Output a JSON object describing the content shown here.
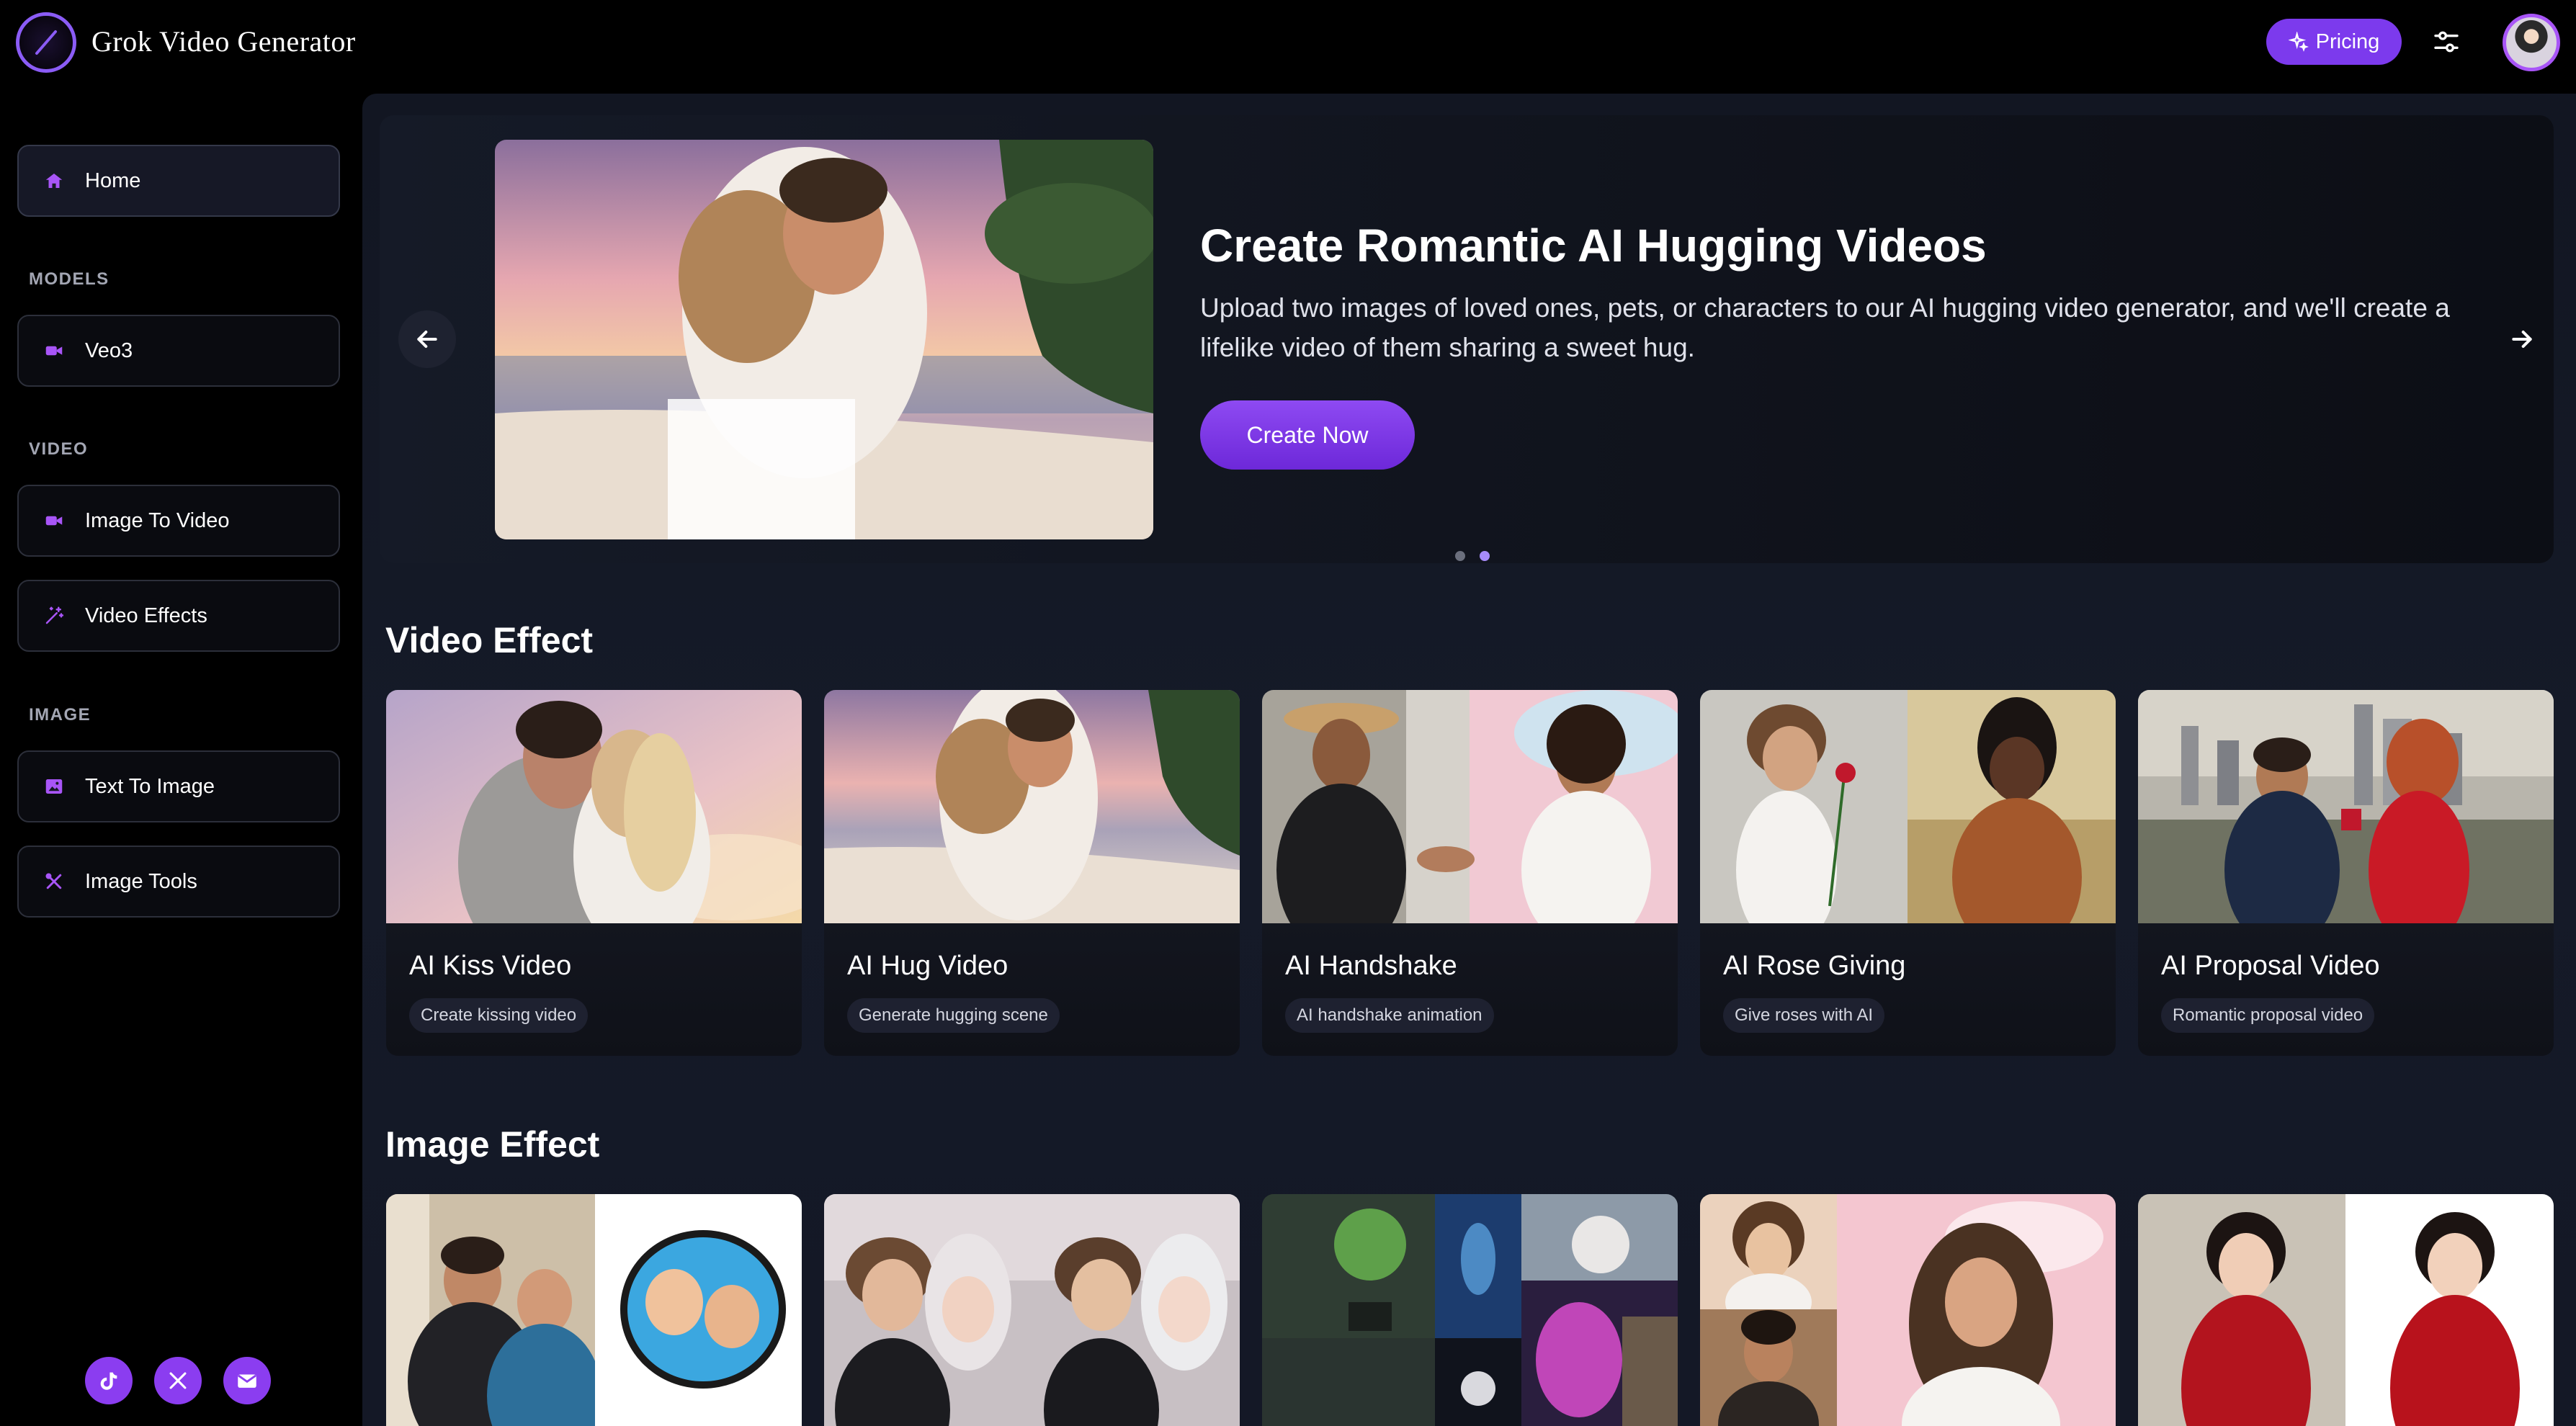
{
  "header": {
    "app_title": "Grok Video Generator",
    "pricing_label": "Pricing",
    "icons": [
      "logo-icon",
      "sparkle-icon",
      "sliders-icon",
      "user-avatar"
    ]
  },
  "sidebar": {
    "home_label": "Home",
    "sections": {
      "models": "MODELS",
      "video": "VIDEO",
      "image": "IMAGE"
    },
    "items": [
      {
        "label": "Veo3",
        "icon": "video-camera-icon"
      },
      {
        "label": "Image To Video",
        "icon": "video-camera-icon"
      },
      {
        "label": "Video Effects",
        "icon": "magic-wand-icon"
      },
      {
        "label": "Text To Image",
        "icon": "image-icon"
      },
      {
        "label": "Image Tools",
        "icon": "tools-icon"
      }
    ],
    "social": [
      "tiktok-icon",
      "x-icon",
      "mail-icon"
    ]
  },
  "hero": {
    "title": "Create Romantic AI Hugging Videos",
    "description": "Upload two images of loved ones, pets, or characters to our AI hugging video generator, and we'll create a lifelike video of them sharing a sweet hug.",
    "cta_label": "Create Now",
    "slide_count": 2,
    "active_slide": 2
  },
  "video_effect": {
    "title": "Video Effect",
    "cards": [
      {
        "title": "AI Kiss Video",
        "tag": "Create kissing video"
      },
      {
        "title": "AI Hug Video",
        "tag": "Generate hugging scene"
      },
      {
        "title": "AI Handshake",
        "tag": "AI handshake animation"
      },
      {
        "title": "AI Rose Giving",
        "tag": "Give roses with AI"
      },
      {
        "title": "AI Proposal Video",
        "tag": "Romantic proposal video"
      }
    ]
  },
  "image_effect": {
    "title": "Image Effect"
  },
  "colors": {
    "accent": "#7c3aed",
    "accent_light": "#a855f7",
    "background": "#000000",
    "main_bg": "#131826"
  }
}
